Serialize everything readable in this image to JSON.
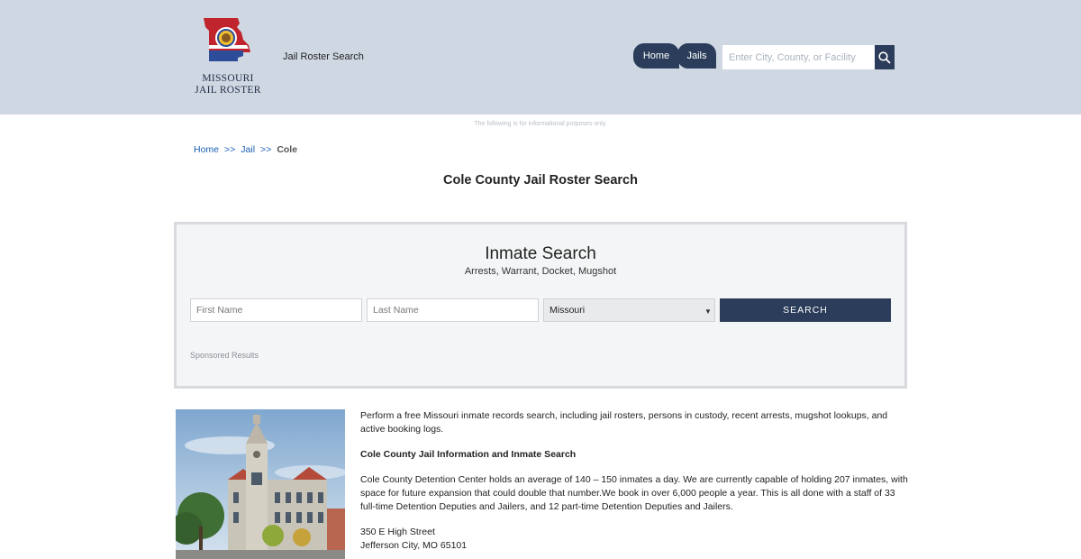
{
  "header": {
    "logo_text_line1": "MISSOURI",
    "logo_text_line2": "JAIL ROSTER",
    "site_title": "Jail Roster Search",
    "nav": [
      {
        "label": "Home"
      },
      {
        "label": "Jails"
      }
    ],
    "search_placeholder": "Enter City, County, or Facility",
    "search_icon": "magnifier-icon"
  },
  "notice": "The following is for informational purposes only.",
  "breadcrumb": {
    "items": [
      "Home",
      "Jail"
    ],
    "separator": ">>",
    "current": "Cole"
  },
  "page_title": "Cole County Jail Roster Search",
  "inmate_search": {
    "title": "Inmate Search",
    "subtitle": "Arrests, Warrant, Docket, Mugshot",
    "first_name_placeholder": "First Name",
    "last_name_placeholder": "Last Name",
    "state_selected": "Missouri",
    "submit_label": "SEARCH",
    "sponsored": "Sponsored Results"
  },
  "content": {
    "intro": "Perform a free Missouri inmate records search, including jail rosters, persons in custody, recent arrests, mugshot lookups, and active booking logs.",
    "heading": "Cole County Jail Information and Inmate Search",
    "body": "Cole County Detention Center holds an average of 140 – 150 inmates a day. We are currently capable of holding 207 inmates, with space for future expansion that could double that number.We book in over 6,000 people a year. This is all done with a staff of 33 full-time Detention Deputies and Jailers, and 12 part-time Detention Deputies and Jailers.",
    "address_line1": "350 E High Street",
    "address_line2": "Jefferson City, MO 65101"
  },
  "colors": {
    "header_bg": "#cfd8e2",
    "accent": "#2b3d5a",
    "link": "#1a5fb4"
  }
}
